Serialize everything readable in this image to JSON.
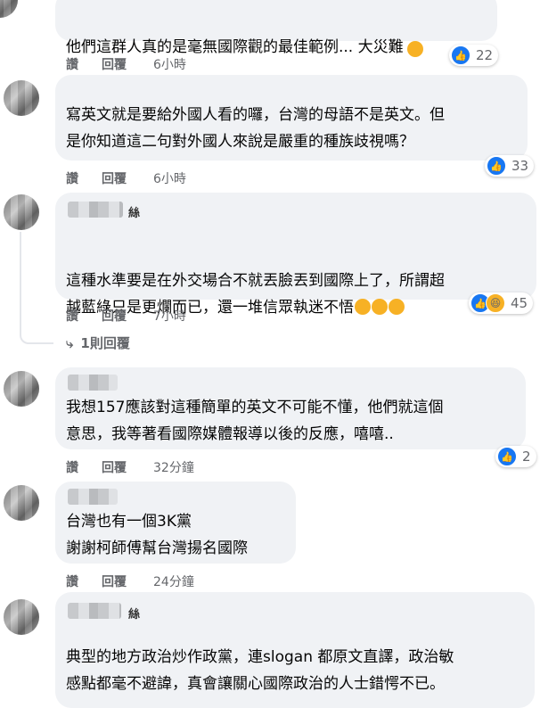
{
  "comments": [
    {
      "text": "他們這群人真的是毫無國際觀的最佳範例... 大災難",
      "emoji": "😔",
      "actions": {
        "like": "讚",
        "reply": "回覆",
        "time": "6小時"
      },
      "reactions": {
        "icons": [
          "like-icon"
        ],
        "count": "22"
      }
    },
    {
      "text": "寫英文就是要給外國人看的囉，台灣的母語不是英文。但\n是你知道這二句對外國人來說是嚴重的種族歧視嗎？",
      "actions": {
        "like": "讚",
        "reply": "回覆",
        "time": "6小時"
      },
      "reactions": {
        "icons": [
          "like-icon"
        ],
        "count": "33"
      }
    },
    {
      "name_suffix": "絲",
      "text": "這種水準要是在外交場合不就丟臉丟到國際上了，所謂超\n越藍綠只是更爛而已，還一堆信眾執迷不悟",
      "emoji": "🤣🤣🤣",
      "actions": {
        "like": "讚",
        "reply": "回覆",
        "time": "7小時"
      },
      "reactions": {
        "icons": [
          "like-icon",
          "haha-icon"
        ],
        "count": "45"
      },
      "replies_label": "1則回覆"
    },
    {
      "text": "我想157應該對這種簡單的英文不可能不懂，他們就這個\n意思，我等著看國際媒體報導以後的反應，嘻嘻..",
      "actions": {
        "like": "讚",
        "reply": "回覆",
        "time": "32分鐘"
      },
      "reactions": {
        "icons": [
          "like-icon"
        ],
        "count": "2"
      }
    },
    {
      "text": "台灣也有一個3K黨\n謝謝柯師傅幫台灣揚名國際",
      "actions": {
        "like": "讚",
        "reply": "回覆",
        "time": "24分鐘"
      }
    },
    {
      "name_suffix": "絲",
      "text": "典型的地方政治炒作政黨，連slogan 都原文直譯，政治敏\n感點都毫不避諱，真會讓關心國際政治的人士錯愕不已。"
    }
  ]
}
